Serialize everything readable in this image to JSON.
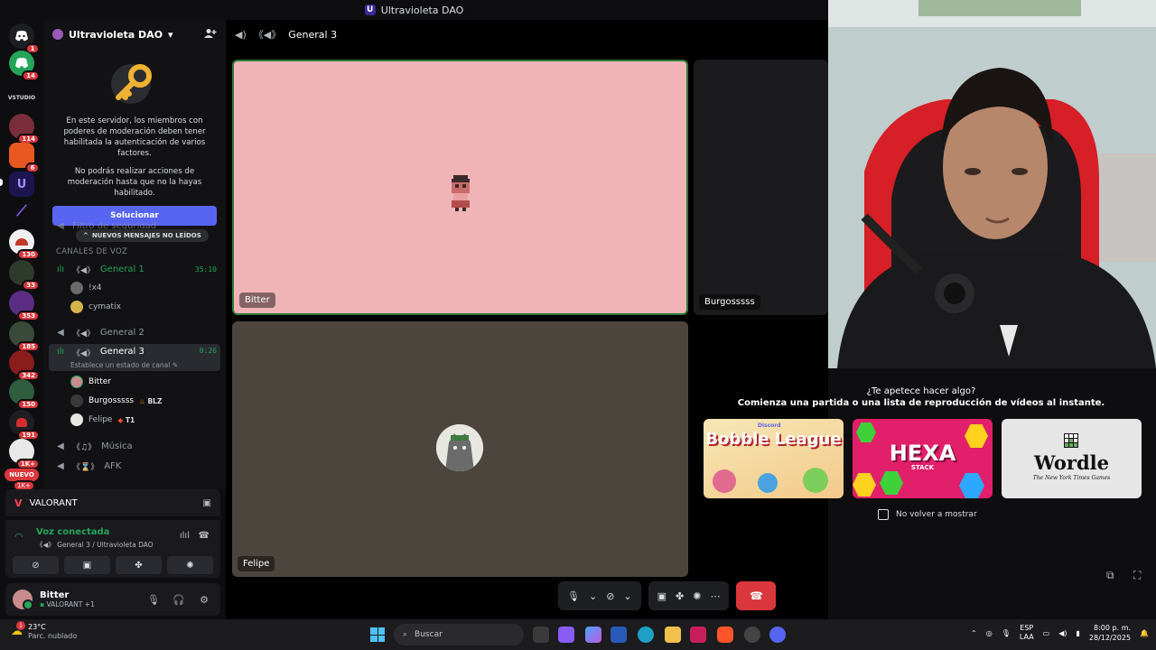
{
  "window": {
    "title": "Ultravioleta DAO"
  },
  "server": {
    "name": "Ultravioleta DAO",
    "chevron": "▾"
  },
  "rail": {
    "badges": [
      "1",
      "14",
      "114",
      "6",
      "130",
      "33",
      "353",
      "185",
      "342",
      "150",
      "191",
      "1K+",
      "1K+"
    ],
    "new_label": "NUEVO",
    "logo_text": "VSTUDIO"
  },
  "mfa_notice": {
    "line1": "En este servidor, los miembros con poderes de moderación deben tener habilitada la autenticación de varios factores.",
    "line2": "No podrás realizar acciones de moderación hasta que no la hayas habilitado.",
    "button": "Solucionar"
  },
  "channels": {
    "filter_label": "Filtro de seguridad",
    "unread_pill": "NUEVOS MENSAJES NO LEÍDOS",
    "voice_category": "CANALES DE VOZ",
    "general1": {
      "name": "General 1",
      "time": "35:10"
    },
    "general1_members": [
      {
        "name": "!x4"
      },
      {
        "name": "cymatix"
      }
    ],
    "general2": {
      "name": "General 2"
    },
    "general3": {
      "name": "General 3",
      "time": "0:26",
      "status": "Establece un estado de canal"
    },
    "general3_members": [
      {
        "name": "Bitter",
        "tag": ""
      },
      {
        "name": "Burgosssss",
        "tag": "BLZ"
      },
      {
        "name": "Felipe",
        "tag": "T1"
      }
    ],
    "musica": {
      "name": "Música"
    },
    "afk": {
      "name": "AFK"
    }
  },
  "activity": {
    "name": "VALORANT"
  },
  "voice_panel": {
    "title": "Voz conectada",
    "subtitle": "General 3 / Ultravioleta DAO"
  },
  "user": {
    "name": "Bitter",
    "status": "VALORANT +1"
  },
  "call": {
    "channel": "General 3",
    "tiles": {
      "bitter": "Bitter",
      "burgos": "Burgosssss",
      "felipe": "Felipe"
    }
  },
  "suggest": {
    "q": "¿Te apetece hacer algo?",
    "sub": "Comienza una partida o una lista de reproducción de vídeos al instante.",
    "games": [
      {
        "name": "Bobble League",
        "brand": "Discord"
      },
      {
        "name": "HEXA",
        "sub": "STACK"
      },
      {
        "name": "Wordle",
        "sub": "The New York Times Games"
      }
    ],
    "dont_show": "No volver a mostrar"
  },
  "taskbar": {
    "temp": "23°C",
    "weather": "Parc. nublado",
    "weather_badge": "1",
    "search": "Buscar",
    "lang_top": "ESP",
    "lang_bottom": "LAA",
    "time": "8:00 p. m.",
    "date": "28/12/2025"
  },
  "colors": {
    "accent": "#5865f2",
    "green": "#23a55a",
    "danger": "#da373c"
  }
}
